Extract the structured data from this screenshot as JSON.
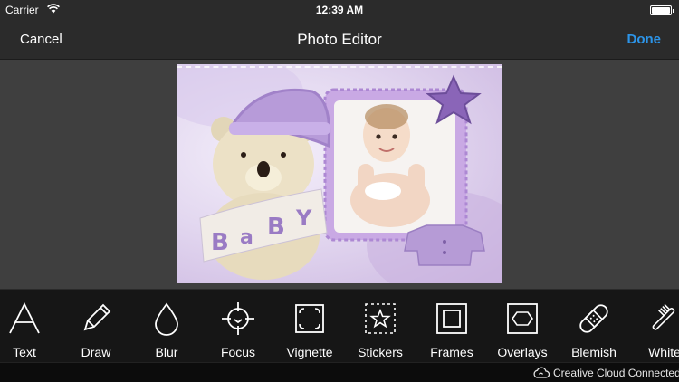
{
  "status_bar": {
    "carrier": "Carrier",
    "time": "12:39 AM"
  },
  "nav": {
    "cancel_label": "Cancel",
    "title": "Photo Editor",
    "done_label": "Done",
    "done_color": "#2c94e8"
  },
  "photo": {
    "banner_letters": [
      "B",
      "a",
      "B",
      "Y"
    ],
    "frame_color": "#b598d6"
  },
  "tools": [
    {
      "icon": "text-icon",
      "label": "Text"
    },
    {
      "icon": "pencil-icon",
      "label": "Draw"
    },
    {
      "icon": "droplet-icon",
      "label": "Blur"
    },
    {
      "icon": "crosshair-icon",
      "label": "Focus"
    },
    {
      "icon": "vignette-icon",
      "label": "Vignette"
    },
    {
      "icon": "star-sticker-icon",
      "label": "Stickers"
    },
    {
      "icon": "frame-icon",
      "label": "Frames"
    },
    {
      "icon": "hexagon-overlay-icon",
      "label": "Overlays"
    },
    {
      "icon": "bandage-icon",
      "label": "Blemish"
    },
    {
      "icon": "whiten-brush-icon",
      "label": "White"
    }
  ],
  "footer": {
    "status_text": "Creative Cloud Connected"
  }
}
